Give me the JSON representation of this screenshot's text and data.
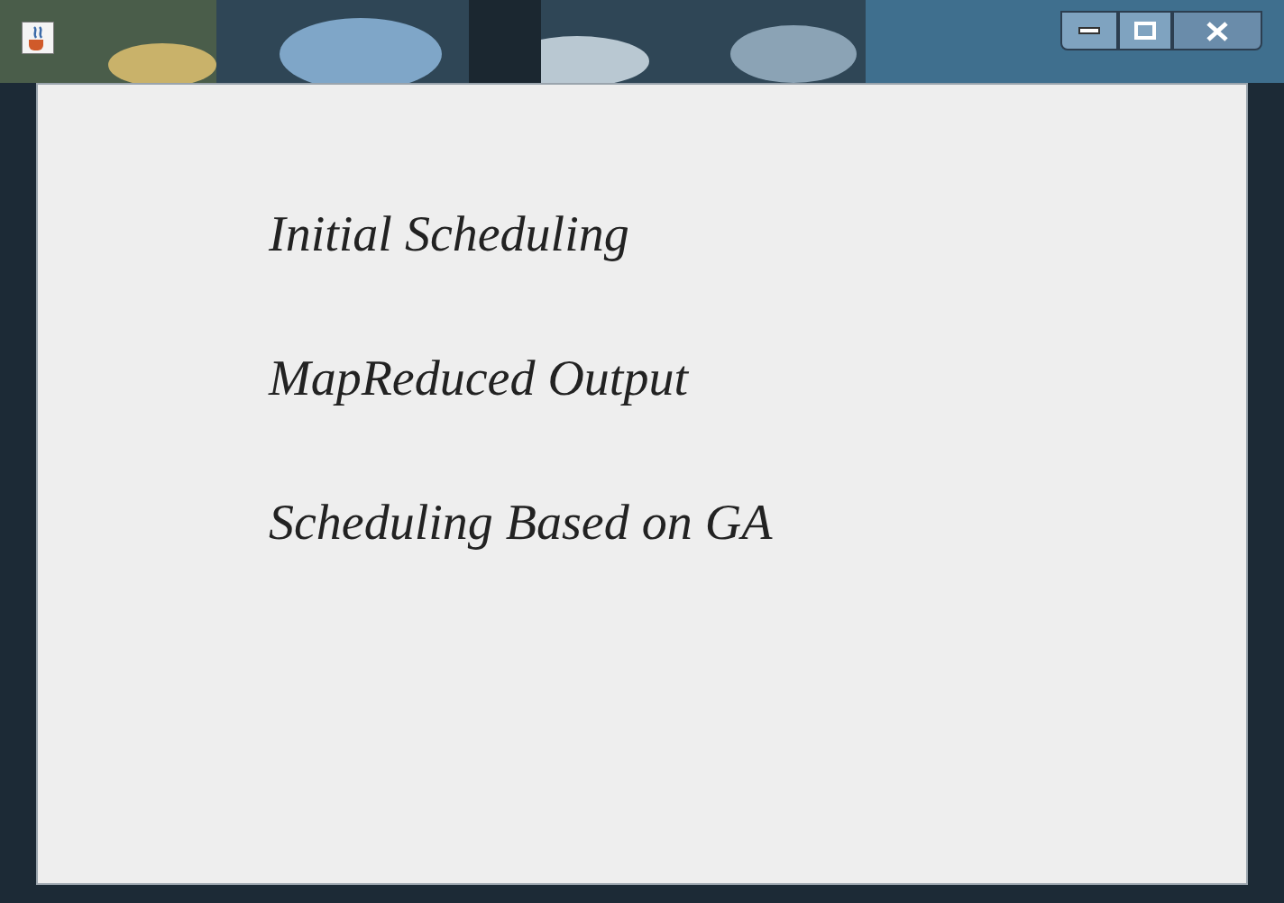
{
  "menu_items": [
    {
      "label": "Initial Scheduling"
    },
    {
      "label": "MapReduced Output"
    },
    {
      "label": "Scheduling Based on GA"
    }
  ]
}
